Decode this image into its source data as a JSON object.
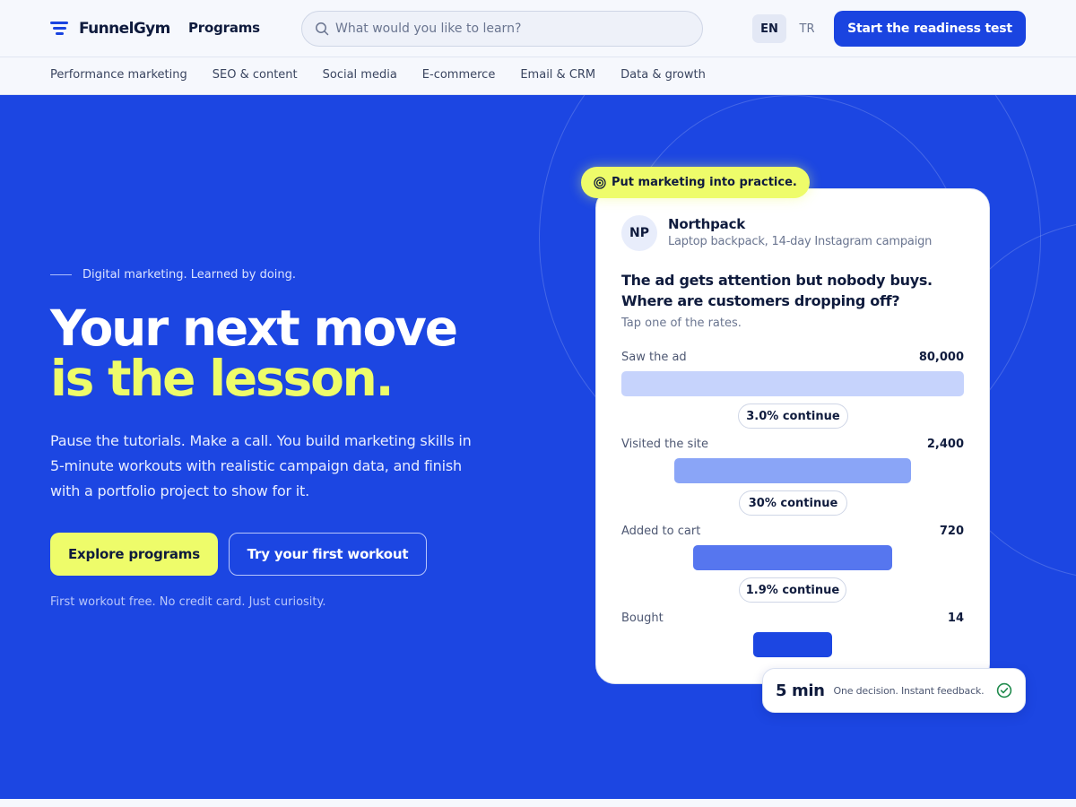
{
  "header": {
    "brand": "FunnelGym",
    "programs_label": "Programs",
    "search_placeholder": "What would you like to learn?",
    "lang_en": "EN",
    "lang_tr": "TR",
    "cta_label": "Start the readiness test"
  },
  "subnav": {
    "items": [
      "Performance marketing",
      "SEO & content",
      "Social media",
      "E-commerce",
      "Email & CRM",
      "Data & growth"
    ]
  },
  "hero": {
    "eyebrow": "Digital marketing. Learned by doing.",
    "headline_line1": "Your next move",
    "headline_line2": "is the lesson.",
    "lede": "Pause the tutorials. Make a call. You build marketing skills in 5-minute workouts with realistic campaign data, and finish with a portfolio project to show for it.",
    "primary_cta": "Explore programs",
    "secondary_cta": "Try your first workout",
    "footnote": "First workout free. No credit card. Just curiosity."
  },
  "card": {
    "tag": "Put marketing into practice.",
    "avatar_initials": "NP",
    "company": "Northpack",
    "campaign": "Laptop backpack, 14-day Instagram campaign",
    "question": "The ad gets attention but nobody buys. Where are customers dropping off?",
    "hint": "Tap one of the rates.",
    "stages": [
      {
        "label": "Saw the ad",
        "value": "80,000",
        "color": "#c6d3fc"
      },
      {
        "label": "Visited the site",
        "value": "2,400",
        "color": "#8aa5f7"
      },
      {
        "label": "Added to cart",
        "value": "720",
        "color": "#5676ef"
      },
      {
        "label": "Bought",
        "value": "14",
        "color": "#1c46e2"
      }
    ],
    "rates": [
      "3.0% continue",
      "30% continue",
      "1.9% continue"
    ]
  },
  "chip": {
    "time": "5 min",
    "caption": "One decision. Instant feedback."
  },
  "colors": {
    "brand_blue": "#1c46e2",
    "accent_yellow": "#eefc6a",
    "ink": "#0f1b3d"
  }
}
